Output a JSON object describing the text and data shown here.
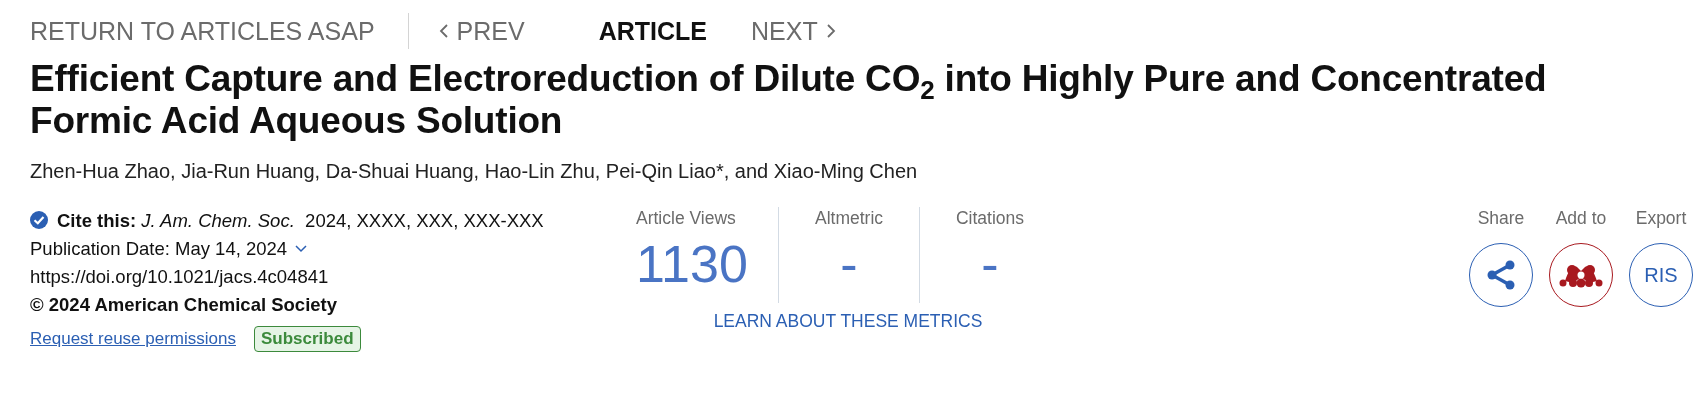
{
  "nav": {
    "return_link": "RETURN TO ARTICLES ASAP",
    "prev": "PREV",
    "current": "ARTICLE",
    "next": "NEXT"
  },
  "title": "Efficient Capture and Electroreduction of Dilute CO$_{2}$ into Highly Pure and Concentrated Formic Acid Aqueous Solution",
  "authors": "Zhen-Hua Zhao, Jia-Run Huang, Da-Shuai Huang, Hao-Lin Zhu, Pei-Qin Liao*, and Xiao-Ming Chen",
  "citation": {
    "label": "Cite this:",
    "journal": "J. Am. Chem. Soc.",
    "details": "2024, XXXX, XXX, XXX-XXX"
  },
  "publication_date": "Publication Date: May 14, 2024",
  "doi": "https://doi.org/10.1021/jacs.4c04841",
  "copyright": "© 2024 American Chemical Society",
  "reuse_link": "Request reuse permissions",
  "access_badge": "Subscribed",
  "metrics": [
    {
      "label": "Article Views",
      "value": "1130"
    },
    {
      "label": "Altmetric",
      "value": "-"
    },
    {
      "label": "Citations",
      "value": "-"
    }
  ],
  "metrics_link": "LEARN ABOUT THESE METRICS",
  "actions": [
    {
      "label": "Share",
      "kind": "share"
    },
    {
      "label": "Add to",
      "kind": "mendeley"
    },
    {
      "label": "Export",
      "kind": "text",
      "text": "RIS"
    }
  ]
}
